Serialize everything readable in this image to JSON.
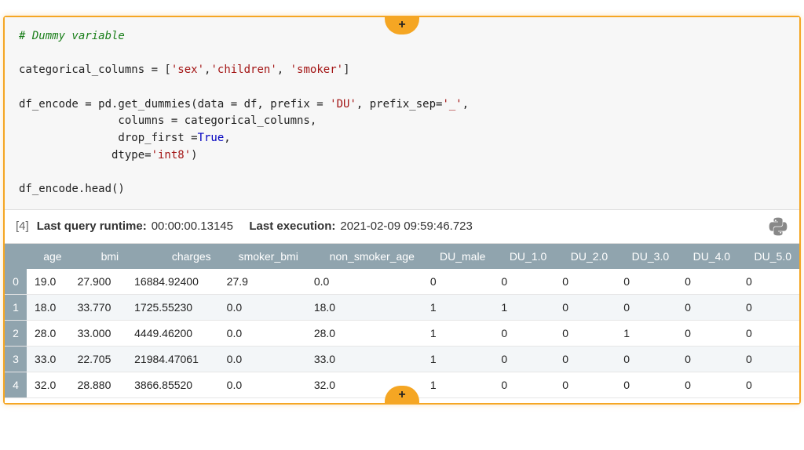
{
  "add_button_glyph": "+",
  "code": {
    "line1_comment": "# Dummy variable",
    "line3a": "categorical_columns = [",
    "line3_s1": "'sex'",
    "line3_s2": "'children'",
    "line3_s3": "'smoker'",
    "line3b": "]",
    "line5a": "df_encode = pd.get_dummies(data = df, prefix = ",
    "line5_s1": "'DU'",
    "line5b": ", prefix_sep=",
    "line5_s2": "'_'",
    "line5c": ",",
    "line6a": "               columns = categorical_columns,",
    "line7a": "               drop_first =",
    "line7_kw": "True",
    "line7b": ",",
    "line8a": "              dtype=",
    "line8_s1": "'int8'",
    "line8b": ")",
    "line10": "df_encode.head()"
  },
  "status": {
    "index": "[4]",
    "runtime_label": "Last query runtime:",
    "runtime_value": "00:00:00.13145",
    "exec_label": "Last execution:",
    "exec_value": "2021-02-09 09:59:46.723"
  },
  "table": {
    "columns": [
      "age",
      "bmi",
      "charges",
      "smoker_bmi",
      "non_smoker_age",
      "DU_male",
      "DU_1.0",
      "DU_2.0",
      "DU_3.0",
      "DU_4.0",
      "DU_5.0"
    ],
    "index": [
      "0",
      "1",
      "2",
      "3",
      "4"
    ],
    "rows": [
      [
        "19.0",
        "27.900",
        "16884.92400",
        "27.9",
        "0.0",
        "0",
        "0",
        "0",
        "0",
        "0",
        "0"
      ],
      [
        "18.0",
        "33.770",
        "1725.55230",
        "0.0",
        "18.0",
        "1",
        "1",
        "0",
        "0",
        "0",
        "0"
      ],
      [
        "28.0",
        "33.000",
        "4449.46200",
        "0.0",
        "28.0",
        "1",
        "0",
        "0",
        "1",
        "0",
        "0"
      ],
      [
        "33.0",
        "22.705",
        "21984.47061",
        "0.0",
        "33.0",
        "1",
        "0",
        "0",
        "0",
        "0",
        "0"
      ],
      [
        "32.0",
        "28.880",
        "3866.85520",
        "0.0",
        "32.0",
        "1",
        "0",
        "0",
        "0",
        "0",
        "0"
      ]
    ]
  }
}
